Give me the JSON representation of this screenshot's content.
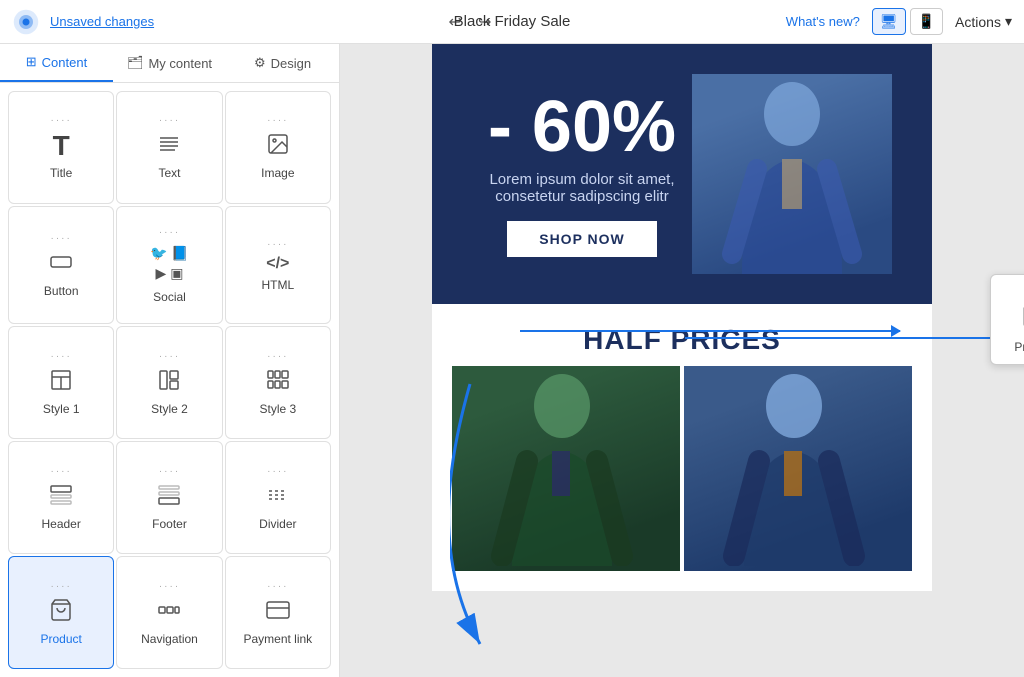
{
  "topbar": {
    "unsaved_label": "Unsaved changes",
    "title": "Black Friday Sale",
    "whatsnew_label": "What's new?",
    "actions_label": "Actions",
    "undo_icon": "↩",
    "redo_icon": "↪"
  },
  "sidebar": {
    "tabs": [
      {
        "id": "content",
        "label": "Content",
        "icon": "⊞",
        "active": true
      },
      {
        "id": "my-content",
        "label": "My content",
        "icon": "🗂"
      },
      {
        "id": "design",
        "label": "Design",
        "icon": "⚙"
      }
    ],
    "items": [
      {
        "id": "title",
        "label": "Title",
        "icon": "T",
        "type": "text"
      },
      {
        "id": "text",
        "label": "Text",
        "icon": "lines",
        "type": "text"
      },
      {
        "id": "image",
        "label": "Image",
        "icon": "image",
        "type": "media"
      },
      {
        "id": "button",
        "label": "Button",
        "icon": "button",
        "type": "interactive"
      },
      {
        "id": "social",
        "label": "Social",
        "icon": "social",
        "type": "social"
      },
      {
        "id": "html",
        "label": "HTML",
        "icon": "html",
        "type": "code"
      },
      {
        "id": "style1",
        "label": "Style 1",
        "icon": "style1",
        "type": "layout"
      },
      {
        "id": "style2",
        "label": "Style 2",
        "icon": "style2",
        "type": "layout"
      },
      {
        "id": "style3",
        "label": "Style 3",
        "icon": "style3",
        "type": "layout"
      },
      {
        "id": "header",
        "label": "Header",
        "icon": "header",
        "type": "layout"
      },
      {
        "id": "footer",
        "label": "Footer",
        "icon": "footer",
        "type": "layout"
      },
      {
        "id": "divider",
        "label": "Divider",
        "icon": "divider",
        "type": "layout"
      },
      {
        "id": "product",
        "label": "Product",
        "icon": "product",
        "type": "ecommerce",
        "highlighted": true
      },
      {
        "id": "navigation",
        "label": "Navigation",
        "icon": "navigation",
        "type": "layout"
      },
      {
        "id": "payment-link",
        "label": "Payment link",
        "icon": "payment",
        "type": "ecommerce"
      }
    ]
  },
  "canvas": {
    "hero": {
      "discount": "- 60%",
      "body_text": "Lorem ipsum dolor sit amet, consetetur sadipscing elitr",
      "cta_label": "SHOP NOW"
    },
    "section_title": "HALF PRICES",
    "floating_product": {
      "label": "Product",
      "dots": "····"
    }
  }
}
